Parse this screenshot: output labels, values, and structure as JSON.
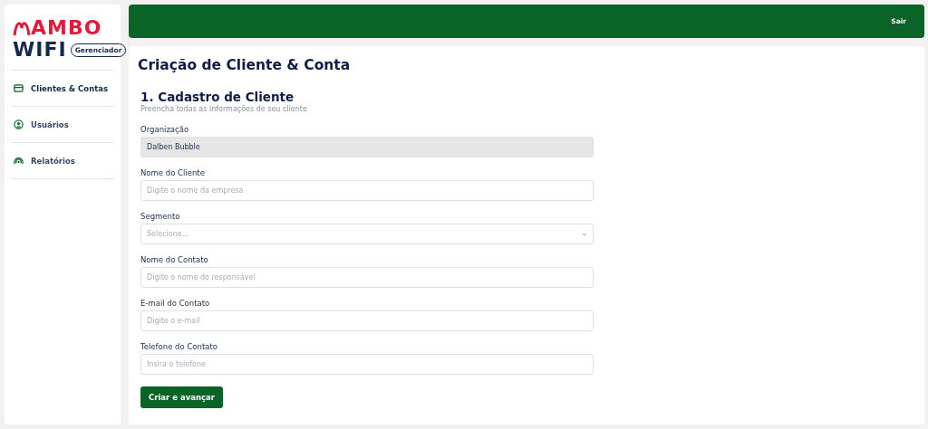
{
  "logo": {
    "line1": "AMBO",
    "line2": "WIFI",
    "badge": "Gerenciador"
  },
  "sidebar": {
    "items": [
      {
        "label": "Clientes & Contas",
        "kind": "card",
        "selected": true
      },
      {
        "label": "Usuários",
        "kind": "user",
        "selected": false
      },
      {
        "label": "Relatórios",
        "kind": "signal",
        "selected": false
      }
    ]
  },
  "topbar": {
    "logout": "Sair"
  },
  "page_title": "Criação de Cliente & Conta",
  "section": {
    "title": "1. Cadastro de Cliente",
    "subtitle": "Preencha todas as informações de seu cliente"
  },
  "fields": [
    {
      "label": "Organização",
      "kind": "input",
      "value": "Dalben Bubble",
      "disabled": true
    },
    {
      "label": "Nome do Cliente",
      "kind": "input",
      "placeholder": "Digite o nome da empresa",
      "disabled": false
    },
    {
      "label": "Segmento",
      "kind": "select",
      "placeholder": "Selecione...",
      "disabled": false
    },
    {
      "label": "Nome do Contato",
      "kind": "input",
      "placeholder": "Digite o nome do responsável",
      "disabled": false
    },
    {
      "label": "E-mail do Contato",
      "kind": "input",
      "placeholder": "Digite o e-mail",
      "disabled": false
    },
    {
      "label": "Telefone do Contato",
      "kind": "input",
      "placeholder": "Insira o telefone",
      "disabled": false
    }
  ],
  "submit": "Criar e avançar"
}
